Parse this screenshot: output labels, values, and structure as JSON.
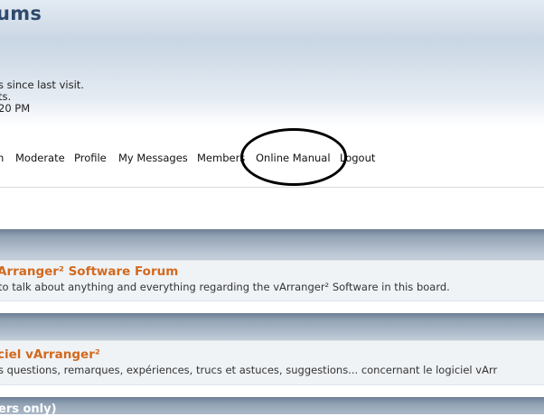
{
  "header": {
    "site_title": "ums",
    "user_info": [
      "s since last visit.",
      "ts.",
      "20 PM"
    ]
  },
  "nav": {
    "items": [
      "n",
      "Moderate",
      "Profile",
      "My Messages",
      "Members",
      "Online Manual",
      "Logout"
    ]
  },
  "forums": [
    {
      "title": "Arranger² Software Forum",
      "description": "to talk about anything and everything regarding the vArranger² Software in this board."
    },
    {
      "title": "ciel vArranger²",
      "description": "s questions, remarques, expériences, trucs et astuces, suggestions... concernant le logiciel vArr"
    }
  ],
  "categories": {
    "third_label": "ers only)"
  }
}
